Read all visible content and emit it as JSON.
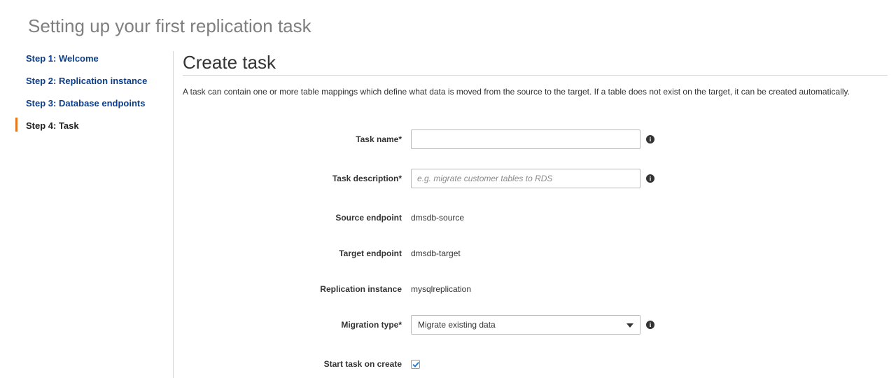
{
  "page_title": "Setting up your first replication task",
  "sidebar": {
    "steps": [
      {
        "label": "Step 1: Welcome",
        "active": false
      },
      {
        "label": "Step 2: Replication instance",
        "active": false
      },
      {
        "label": "Step 3: Database endpoints",
        "active": false
      },
      {
        "label": "Step 4: Task",
        "active": true
      }
    ]
  },
  "main": {
    "heading": "Create task",
    "description": "A task can contain one or more table mappings which define what data is moved from the source to the target. If a table does not exist on the target, it can be created automatically.",
    "form": {
      "task_name": {
        "label": "Task name*",
        "value": "",
        "placeholder": ""
      },
      "task_description": {
        "label": "Task description*",
        "value": "",
        "placeholder": "e.g. migrate customer tables to RDS"
      },
      "source_endpoint": {
        "label": "Source endpoint",
        "value": "dmsdb-source"
      },
      "target_endpoint": {
        "label": "Target endpoint",
        "value": "dmsdb-target"
      },
      "replication_instance": {
        "label": "Replication instance",
        "value": "mysqlreplication"
      },
      "migration_type": {
        "label": "Migration type*",
        "selected": "Migrate existing data"
      },
      "start_task_on_create": {
        "label": "Start task on create",
        "checked": true
      }
    }
  },
  "icons": {
    "info": "info-icon",
    "dropdown": "caret-down-icon",
    "checkmark": "checkmark-icon"
  },
  "colors": {
    "link": "#0b3e8c",
    "active_indicator": "#e8761e",
    "checkmark": "#1a73c8"
  }
}
